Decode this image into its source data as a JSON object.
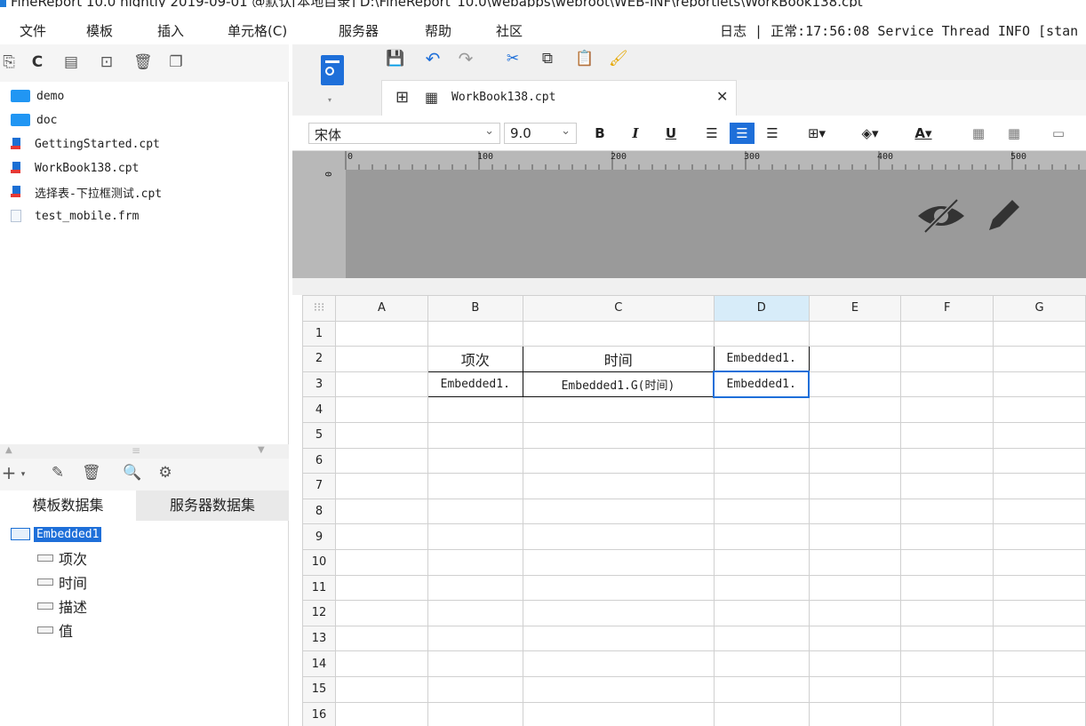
{
  "window": {
    "title": "FineReport 10.0 nightly 2019-09-01 @默认[本地目录]   D:\\FineReport_10.0\\webapps\\webroot\\WEB-INF\\reportlets\\WorkBook138.cpt"
  },
  "menu": {
    "items": [
      "文件",
      "模板",
      "插入",
      "单元格(C)",
      "服务器",
      "帮助",
      "社区"
    ],
    "log": "日志 | 正常:17:56:08 Service Thread INFO [stan"
  },
  "files": [
    {
      "name": "demo",
      "type": "folder"
    },
    {
      "name": "doc",
      "type": "folder"
    },
    {
      "name": "GettingStarted.cpt",
      "type": "cpt"
    },
    {
      "name": "WorkBook138.cpt",
      "type": "cpt"
    },
    {
      "name": "选择表-下拉框测试.cpt",
      "type": "cpt"
    },
    {
      "name": "test_mobile.frm",
      "type": "frm"
    }
  ],
  "datasets": {
    "tabs": [
      "模板数据集",
      "服务器数据集"
    ],
    "dataset": "Embedded1",
    "fields": [
      "项次",
      "时间",
      "描述",
      "值"
    ]
  },
  "tab": {
    "name": "WorkBook138.cpt"
  },
  "format": {
    "font": "宋体",
    "size": "9.0"
  },
  "ruler": {
    "ticks": [
      "0",
      "100",
      "200",
      "300",
      "400",
      "500"
    ]
  },
  "sheet": {
    "columns": [
      "A",
      "B",
      "C",
      "D",
      "E",
      "F",
      "G"
    ],
    "rows": [
      "1",
      "2",
      "3",
      "4",
      "5",
      "6",
      "7",
      "8",
      "9",
      "10",
      "11",
      "12",
      "13",
      "14",
      "15",
      "16"
    ],
    "cells": {
      "B2": "项次",
      "C2": "时间",
      "D2": "Embedded1.",
      "B3": "Embedded1.",
      "C3": "Embedded1.G(时间)",
      "D3": "Embedded1."
    }
  }
}
